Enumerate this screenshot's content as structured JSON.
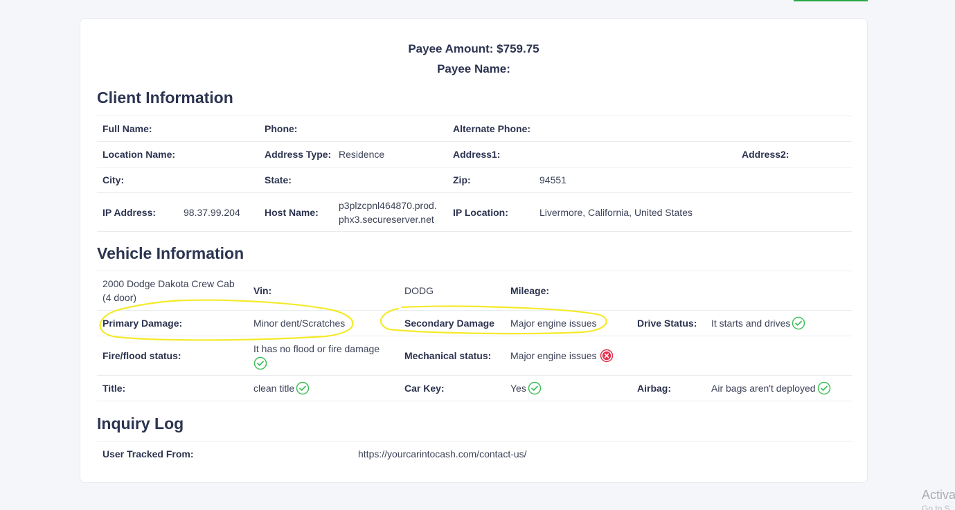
{
  "payee": {
    "amount": "Payee Amount: $759.75",
    "name": "Payee Name:"
  },
  "client": {
    "title": "Client Information",
    "full_name_label": "Full Name:",
    "phone_label": "Phone:",
    "alt_phone_label": "Alternate Phone:",
    "location_name_label": "Location Name:",
    "address_type_label": "Address Type:",
    "address_type_value": "Residence",
    "address1_label": "Address1:",
    "address2_label": "Address2:",
    "city_label": "City:",
    "state_label": "State:",
    "zip_label": "Zip:",
    "zip_value": "94551",
    "ip_label": "IP Address:",
    "ip_value": "98.37.99.204",
    "host_label": "Host Name:",
    "host_value_line1": "p3plzcpnl464870.prod.",
    "host_value_line2": "phx3.secureserver.net",
    "ip_location_label": "IP Location:",
    "ip_location_value": "Livermore, California, United States"
  },
  "vehicle": {
    "title": "Vehicle Information",
    "model_line1": "2000 Dodge Dakota Crew Cab",
    "model_line2": "(4 door)",
    "vin_label": "Vin:",
    "vin_value": "DODG",
    "mileage_label": "Mileage:",
    "primary_damage_label": "Primary Damage:",
    "primary_damage_value": "Minor dent/Scratches",
    "secondary_damage_label": "Secondary Damage",
    "secondary_damage_value": "Major engine issues",
    "drive_status_label": "Drive Status:",
    "drive_status_value": "It starts and drives",
    "fire_flood_label": "Fire/flood status:",
    "fire_flood_value": "It has no flood or fire damage",
    "mechanical_label": "Mechanical status:",
    "mechanical_value": "Major engine issues",
    "title_label": "Title:",
    "title_value": "clean title",
    "car_key_label": "Car Key:",
    "car_key_value": "Yes",
    "airbag_label": "Airbag:",
    "airbag_value": "Air bags aren't deployed"
  },
  "inquiry": {
    "title": "Inquiry Log",
    "tracked_label": "User Tracked From:",
    "tracked_value": "https://yourcarintocash.com/contact-us/"
  },
  "watermark": {
    "line1": "Activa",
    "line2": "Go to S"
  },
  "colors": {
    "ok": "#3fbf5b",
    "bad": "#e2334f",
    "highlight": "#f4ea2a",
    "accent": "#28a745"
  },
  "icons": {
    "ok": "check-circle-icon",
    "bad": "x-circle-icon"
  }
}
